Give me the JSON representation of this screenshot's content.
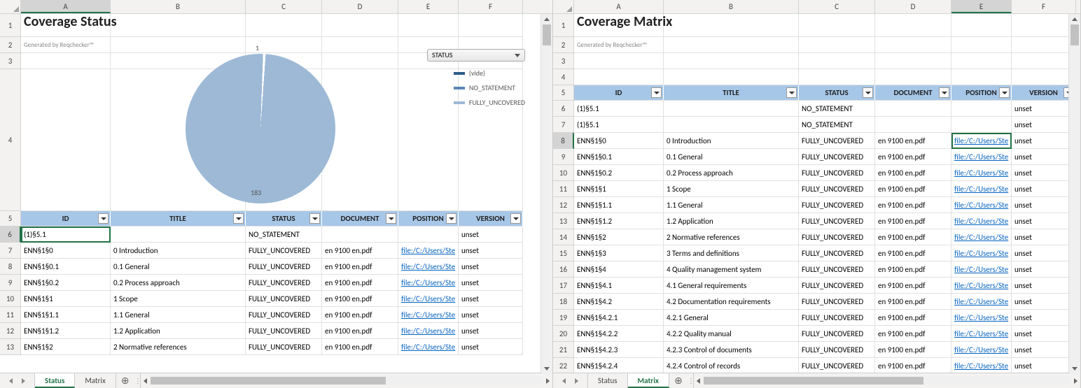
{
  "left": {
    "title": "Coverage Status",
    "subtitle": "Generated by Reqchecker™",
    "selected_cell": "A6",
    "slicer_label": "STATUS",
    "legend": [
      {
        "label": "(vide)",
        "color": "#2e5c8a"
      },
      {
        "label": "NO_STATEMENT",
        "color": "#5b87b5"
      },
      {
        "label": "FULLY_UNCOVERED",
        "color": "#9db9d6"
      }
    ],
    "headers": [
      "ID",
      "TITLE",
      "STATUS",
      "DOCUMENT",
      "POSITION",
      "VERSION"
    ],
    "rows": [
      {
        "id": "(1)§5.1",
        "title": "",
        "status": "NO_STATEMENT",
        "doc": "",
        "pos": "",
        "ver": "unset"
      },
      {
        "id": "ENN§1§0",
        "title": "0 Introduction",
        "status": "FULLY_UNCOVERED",
        "doc": "en 9100 en.pdf",
        "pos": "file:/C:/Users/Ste",
        "ver": "unset"
      },
      {
        "id": "ENN§1§0.1",
        "title": "0.1 General",
        "status": "FULLY_UNCOVERED",
        "doc": "en 9100 en.pdf",
        "pos": "file:/C:/Users/Ste",
        "ver": "unset"
      },
      {
        "id": "ENN§1§0.2",
        "title": "0.2 Process approach",
        "status": "FULLY_UNCOVERED",
        "doc": "en 9100 en.pdf",
        "pos": "file:/C:/Users/Ste",
        "ver": "unset"
      },
      {
        "id": "ENN§1§1",
        "title": "1 Scope",
        "status": "FULLY_UNCOVERED",
        "doc": "en 9100 en.pdf",
        "pos": "file:/C:/Users/Ste",
        "ver": "unset"
      },
      {
        "id": "ENN§1§1.1",
        "title": "1.1 General",
        "status": "FULLY_UNCOVERED",
        "doc": "en 9100 en.pdf",
        "pos": "file:/C:/Users/Ste",
        "ver": "unset"
      },
      {
        "id": "ENN§1§1.2",
        "title": "1.2 Application",
        "status": "FULLY_UNCOVERED",
        "doc": "en 9100 en.pdf",
        "pos": "file:/C:/Users/Ste",
        "ver": "unset"
      },
      {
        "id": "ENN§1§2",
        "title": "2 Normative references",
        "status": "FULLY_UNCOVERED",
        "doc": "en 9100 en.pdf",
        "pos": "file:/C:/Users/Ste",
        "ver": "unset"
      }
    ],
    "tabs": [
      "Status",
      "Matrix"
    ],
    "active_tab": "Status"
  },
  "right": {
    "title": "Coverage Matrix",
    "subtitle": "Generated by Reqchecker™",
    "selected_cell": "E8",
    "headers": [
      "ID",
      "TITLE",
      "STATUS",
      "DOCUMENT",
      "POSITION",
      "VERSION"
    ],
    "rows": [
      {
        "id": "(1)§5.1",
        "title": "",
        "status": "NO_STATEMENT",
        "doc": "",
        "pos": "",
        "ver": "unset"
      },
      {
        "id": "(1)§5.1",
        "title": "",
        "status": "NO_STATEMENT",
        "doc": "",
        "pos": "",
        "ver": "unset"
      },
      {
        "id": "ENN§1§0",
        "title": "0 Introduction",
        "status": "FULLY_UNCOVERED",
        "doc": "en 9100 en.pdf",
        "pos": "file:/C:/Users/Ste",
        "ver": "unset"
      },
      {
        "id": "ENN§1§0.1",
        "title": "0.1 General",
        "status": "FULLY_UNCOVERED",
        "doc": "en 9100 en.pdf",
        "pos": "file:/C:/Users/Ste",
        "ver": "unset"
      },
      {
        "id": "ENN§1§0.2",
        "title": "0.2 Process approach",
        "status": "FULLY_UNCOVERED",
        "doc": "en 9100 en.pdf",
        "pos": "file:/C:/Users/Ste",
        "ver": "unset"
      },
      {
        "id": "ENN§1§1",
        "title": "1 Scope",
        "status": "FULLY_UNCOVERED",
        "doc": "en 9100 en.pdf",
        "pos": "file:/C:/Users/Ste",
        "ver": "unset"
      },
      {
        "id": "ENN§1§1.1",
        "title": "1.1 General",
        "status": "FULLY_UNCOVERED",
        "doc": "en 9100 en.pdf",
        "pos": "file:/C:/Users/Ste",
        "ver": "unset"
      },
      {
        "id": "ENN§1§1.2",
        "title": "1.2 Application",
        "status": "FULLY_UNCOVERED",
        "doc": "en 9100 en.pdf",
        "pos": "file:/C:/Users/Ste",
        "ver": "unset"
      },
      {
        "id": "ENN§1§2",
        "title": "2 Normative references",
        "status": "FULLY_UNCOVERED",
        "doc": "en 9100 en.pdf",
        "pos": "file:/C:/Users/Ste",
        "ver": "unset"
      },
      {
        "id": "ENN§1§3",
        "title": "3 Terms and definitions",
        "status": "FULLY_UNCOVERED",
        "doc": "en 9100 en.pdf",
        "pos": "file:/C:/Users/Ste",
        "ver": "unset"
      },
      {
        "id": "ENN§1§4",
        "title": "4 Quality management system",
        "status": "FULLY_UNCOVERED",
        "doc": "en 9100 en.pdf",
        "pos": "file:/C:/Users/Ste",
        "ver": "unset"
      },
      {
        "id": "ENN§1§4.1",
        "title": "4.1 General requirements",
        "status": "FULLY_UNCOVERED",
        "doc": "en 9100 en.pdf",
        "pos": "file:/C:/Users/Ste",
        "ver": "unset"
      },
      {
        "id": "ENN§1§4.2",
        "title": "4.2 Documentation requirements",
        "status": "FULLY_UNCOVERED",
        "doc": "en 9100 en.pdf",
        "pos": "file:/C:/Users/Ste",
        "ver": "unset"
      },
      {
        "id": "ENN§1§4.2.1",
        "title": "4.2.1 General",
        "status": "FULLY_UNCOVERED",
        "doc": "en 9100 en.pdf",
        "pos": "file:/C:/Users/Ste",
        "ver": "unset"
      },
      {
        "id": "ENN§1§4.2.2",
        "title": "4.2.2 Quality manual",
        "status": "FULLY_UNCOVERED",
        "doc": "en 9100 en.pdf",
        "pos": "file:/C:/Users/Ste",
        "ver": "unset"
      },
      {
        "id": "ENN§1§4.2.3",
        "title": "4.2.3 Control of documents",
        "status": "FULLY_UNCOVERED",
        "doc": "en 9100 en.pdf",
        "pos": "file:/C:/Users/Ste",
        "ver": "unset"
      },
      {
        "id": "ENN§1§4.2.4",
        "title": "4.2.4 Control of records",
        "status": "FULLY_UNCOVERED",
        "doc": "en 9100 en.pdf",
        "pos": "file:/C:/Users/Ste",
        "ver": "unset"
      }
    ],
    "tabs": [
      "Status",
      "Matrix"
    ],
    "active_tab": "Matrix"
  },
  "chart_data": {
    "type": "pie",
    "title": "",
    "slicer": "STATUS",
    "series": [
      {
        "name": "(vide)",
        "value": 0,
        "color": "#2e5c8a"
      },
      {
        "name": "NO_STATEMENT",
        "value": 1,
        "color": "#5b87b5"
      },
      {
        "name": "FULLY_UNCOVERED",
        "value": 183,
        "color": "#9db9d6"
      }
    ],
    "labels": {
      "top": "1",
      "mid": "183"
    }
  }
}
